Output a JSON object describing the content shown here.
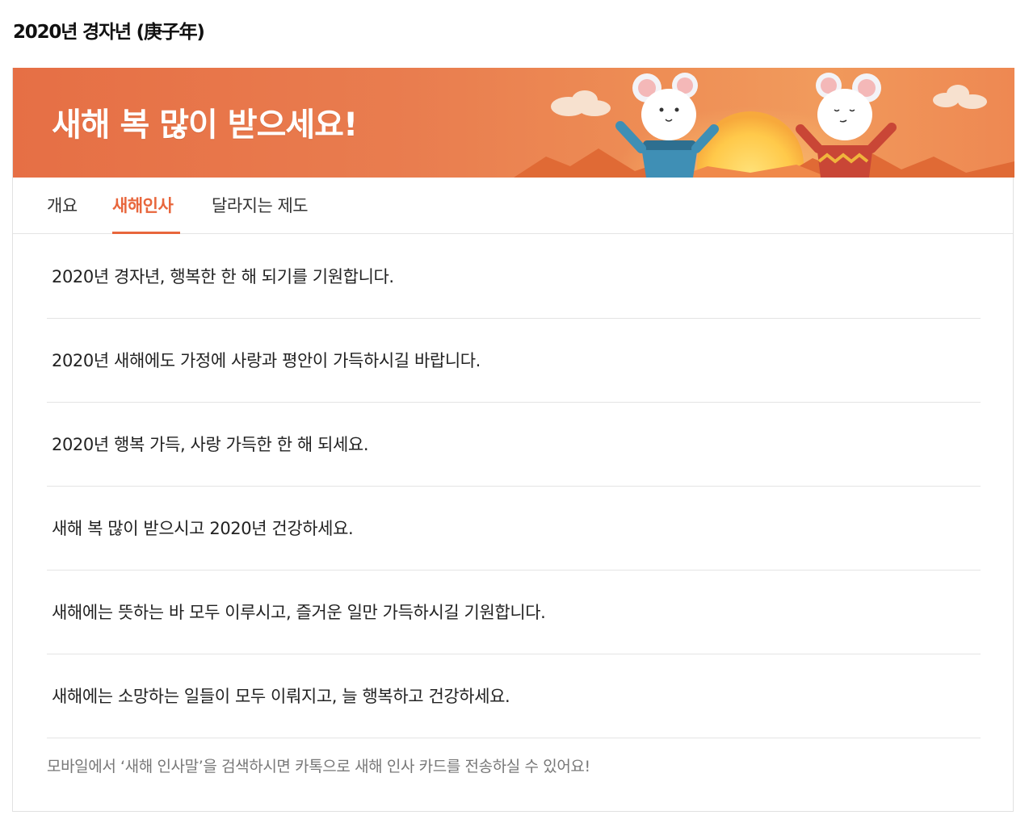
{
  "page": {
    "title": "2020년 경자년 (庚子年)"
  },
  "banner": {
    "title": "새해 복 많이 받으세요!"
  },
  "tabs": [
    {
      "label": "개요",
      "active": false
    },
    {
      "label": "새해인사",
      "active": true
    },
    {
      "label": "달라지는 제도",
      "active": false
    }
  ],
  "greetings": [
    "2020년 경자년, 행복한 한 해 되기를 기원합니다.",
    "2020년 새해에도 가정에 사랑과 평안이 가득하시길 바랍니다.",
    "2020년 행복 가득, 사랑 가득한 한 해 되세요.",
    "새해 복 많이 받으시고 2020년 건강하세요.",
    "새해에는 뜻하는 바 모두 이루시고, 즐거운 일만 가득하시길 기원합니다.",
    "새해에는 소망하는 일들이 모두 이뤄지고, 늘 행복하고 건강하세요."
  ],
  "footnote": "모바일에서 ‘새해 인사말’을 검색하시면 카톡으로 새해 인사 카드를 전송하실 수 있어요!",
  "colors": {
    "accent": "#e8663c",
    "banner_bg": "#e97d4f",
    "divider": "#e4e4e4"
  }
}
